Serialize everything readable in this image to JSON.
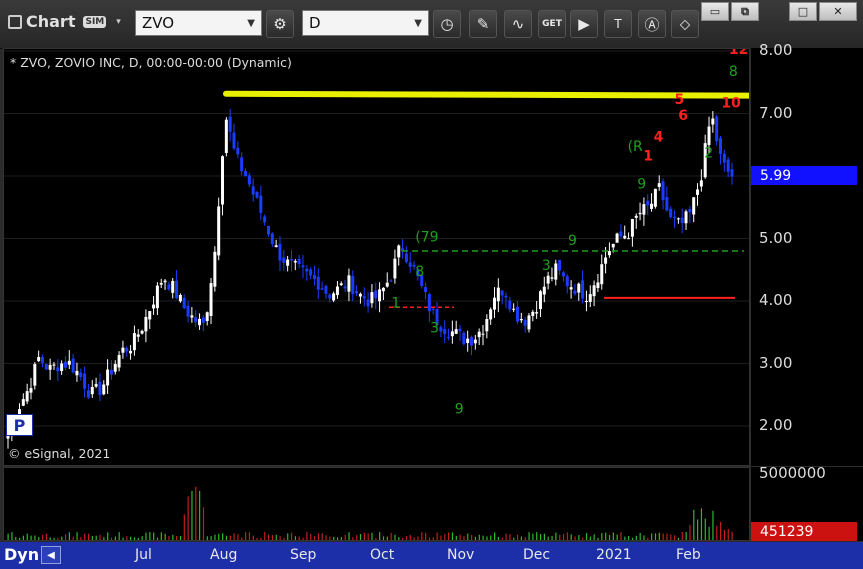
{
  "toolbar": {
    "title": "Chart",
    "sim_badge": "SIM",
    "symbol": "ZVO",
    "interval": "D",
    "get_label": "GET",
    "tools": [
      "link-icon",
      "clock-icon",
      "pencil-icon",
      "indicator-icon",
      "get-icon",
      "play-icon",
      "text-icon",
      "alert-icon",
      "cursor-icon"
    ]
  },
  "window_buttons": [
    "restore-icon",
    "popout-icon",
    "maximize-icon",
    "close-icon"
  ],
  "chart": {
    "legend": "* ZVO, ZOVIO INC, D, 00:00-00:00 (Dynamic)",
    "copyright": "© eSignal, 2021",
    "p_marker": "P",
    "price_axis_labels": [
      "8.00",
      "7.00",
      "6.00",
      "5.00",
      "4.00",
      "3.00",
      "2.00"
    ],
    "last_price": "5.99",
    "volume_axis_label": "5000000",
    "last_volume": "451239",
    "x_axis_labels": [
      "Jul",
      "Aug",
      "Sep",
      "Oct",
      "Nov",
      "Dec",
      "2021",
      "Feb"
    ],
    "scrollbar_label": "Dyn",
    "colors": {
      "up": "#ffffff",
      "down": "#1a3cff",
      "resistance": "#e8f000",
      "support": "#ff2020",
      "count": "#1fa01f",
      "sell_count": "#ff2020",
      "axis_bar": "#1c2fa8"
    }
  },
  "chart_data": {
    "type": "candlestick",
    "symbol": "ZVO",
    "ylim": [
      1.5,
      8.0
    ],
    "y_ticks": [
      2.0,
      3.0,
      4.0,
      5.0,
      6.0,
      7.0,
      8.0
    ],
    "x_ticks": [
      "Jul",
      "Aug",
      "Sep",
      "Oct",
      "Nov",
      "Dec",
      "2021",
      "Feb"
    ],
    "last": 5.99,
    "resistance_line": 7.3,
    "support_lines": [
      3.9,
      4.05
    ],
    "dashed_level": 4.8,
    "path": [
      1.9,
      2.3,
      2.6,
      3.1,
      2.9,
      3.0,
      3.0,
      2.8,
      2.5,
      2.6,
      2.9,
      3.2,
      3.3,
      3.6,
      4.0,
      4.4,
      4.2,
      3.9,
      3.7,
      3.6,
      4.8,
      7.0,
      6.3,
      6.0,
      5.6,
      5.2,
      4.8,
      4.6,
      4.5,
      4.4,
      4.3,
      4.1,
      4.2,
      4.3,
      4.1,
      4.0,
      4.1,
      4.4,
      4.9,
      4.6,
      4.2,
      3.8,
      3.6,
      3.5,
      3.4,
      3.4,
      3.6,
      4.1,
      4.2,
      3.8,
      3.7,
      3.9,
      4.3,
      4.5,
      4.3,
      4.2,
      4.1,
      4.4,
      4.8,
      5.0,
      5.1,
      5.4,
      5.5,
      5.8,
      5.3,
      5.2,
      5.4,
      6.0,
      7.0,
      6.2,
      5.99
    ],
    "volume_axis": 5000000,
    "last_volume": 451239,
    "td_counts": [
      {
        "label": "8",
        "x": 0.552,
        "y": 4.4
      },
      {
        "label": "(79",
        "x": 0.552,
        "y": 4.95
      },
      {
        "label": "1",
        "x": 0.52,
        "y": 3.9
      },
      {
        "label": "3",
        "x": 0.572,
        "y": 3.5
      },
      {
        "label": "9",
        "x": 0.605,
        "y": 2.2
      },
      {
        "label": "9",
        "x": 0.757,
        "y": 4.9
      },
      {
        "label": "3",
        "x": 0.722,
        "y": 4.5
      },
      {
        "label": "(R",
        "x": 0.837,
        "y": 6.4
      },
      {
        "label": "9",
        "x": 0.85,
        "y": 5.8
      },
      {
        "label": "8",
        "x": 0.973,
        "y": 7.6
      },
      {
        "label": "2",
        "x": 0.94,
        "y": 6.3
      }
    ],
    "sell_counts": [
      {
        "label": "5",
        "x": 0.9,
        "y": 7.15
      },
      {
        "label": "6",
        "x": 0.905,
        "y": 6.9
      },
      {
        "label": "4",
        "x": 0.872,
        "y": 6.55
      },
      {
        "label": "1",
        "x": 0.858,
        "y": 6.25
      },
      {
        "label": "10",
        "x": 0.963,
        "y": 7.1
      },
      {
        "label": "12",
        "x": 0.973,
        "y": 7.95
      }
    ]
  }
}
